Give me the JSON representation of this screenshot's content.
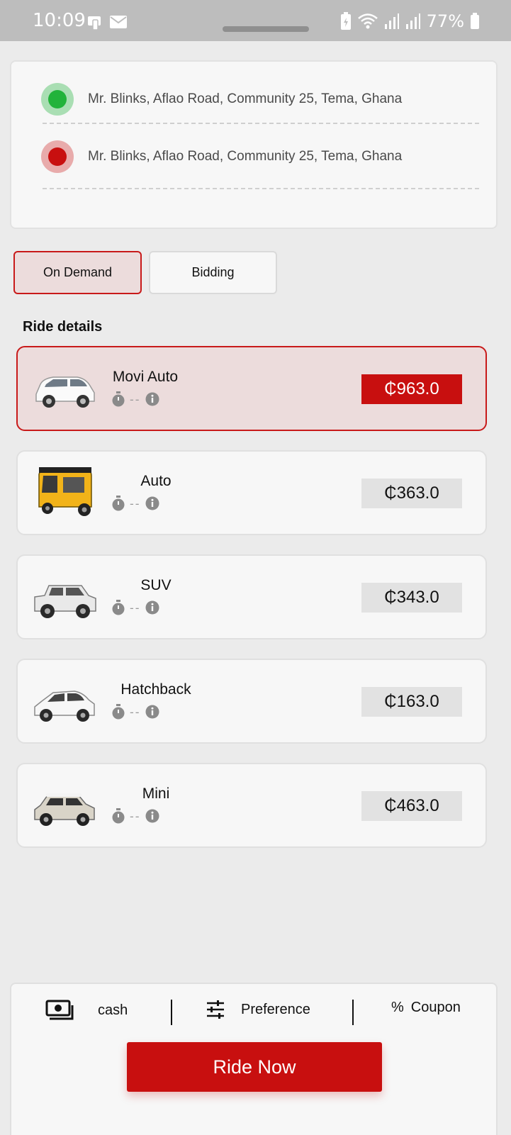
{
  "status_bar": {
    "time": "10:09",
    "battery": "77%"
  },
  "route": {
    "pickup": "Mr. Blinks, Aflao Road, Community 25, Tema, Ghana",
    "dropoff": "Mr. Blinks, Aflao Road, Community 25, Tema, Ghana",
    "pickup_color": "#22b33b",
    "dropoff_color": "#c80f0f"
  },
  "modes": {
    "on_demand": "On Demand",
    "bidding": "Bidding",
    "selected": "On Demand"
  },
  "ride_details_title": "Ride details",
  "rides": [
    {
      "name": "Movi Auto",
      "eta": "--",
      "price": "₵963.0",
      "vehicle": "white-minivan",
      "selected": true
    },
    {
      "name": "Auto",
      "eta": "--",
      "price": "₵363.0",
      "vehicle": "yellow-auto-rickshaw",
      "selected": false
    },
    {
      "name": "SUV",
      "eta": "--",
      "price": "₵343.0",
      "vehicle": "white-suv",
      "selected": false
    },
    {
      "name": "Hatchback",
      "eta": "--",
      "price": "₵163.0",
      "vehicle": "white-hatchback",
      "selected": false
    },
    {
      "name": "Mini",
      "eta": "--",
      "price": "₵463.0",
      "vehicle": "mini-cooper",
      "selected": false
    }
  ],
  "options": {
    "payment": "cash",
    "preference": "Preference",
    "coupon": "Coupon",
    "coupon_symbol": "%"
  },
  "cta": "Ride Now",
  "accent_color": "#c80f0f"
}
